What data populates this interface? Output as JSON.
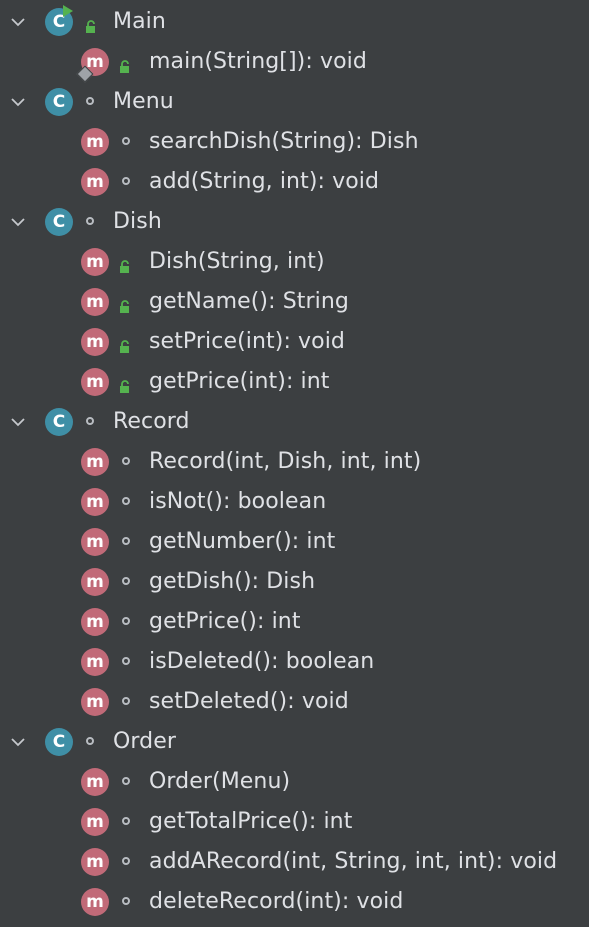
{
  "tree": [
    {
      "class_name": "Main",
      "class_visibility": "public",
      "icon_letter": "C",
      "run_badge": true,
      "methods": [
        {
          "signature": "main(String[]): void",
          "visibility": "public",
          "icon_letter": "m",
          "entry_badge": true
        }
      ]
    },
    {
      "class_name": "Menu",
      "class_visibility": "package",
      "icon_letter": "C",
      "methods": [
        {
          "signature": "searchDish(String): Dish",
          "visibility": "package",
          "icon_letter": "m"
        },
        {
          "signature": "add(String, int): void",
          "visibility": "package",
          "icon_letter": "m"
        }
      ]
    },
    {
      "class_name": "Dish",
      "class_visibility": "package",
      "icon_letter": "C",
      "methods": [
        {
          "signature": "Dish(String, int)",
          "visibility": "public",
          "icon_letter": "m"
        },
        {
          "signature": "getName(): String",
          "visibility": "public",
          "icon_letter": "m"
        },
        {
          "signature": "setPrice(int): void",
          "visibility": "public",
          "icon_letter": "m"
        },
        {
          "signature": "getPrice(int): int",
          "visibility": "public",
          "icon_letter": "m"
        }
      ]
    },
    {
      "class_name": "Record",
      "class_visibility": "package",
      "icon_letter": "C",
      "methods": [
        {
          "signature": "Record(int, Dish, int, int)",
          "visibility": "package",
          "icon_letter": "m"
        },
        {
          "signature": "isNot(): boolean",
          "visibility": "package",
          "icon_letter": "m"
        },
        {
          "signature": "getNumber(): int",
          "visibility": "package",
          "icon_letter": "m"
        },
        {
          "signature": "getDish(): Dish",
          "visibility": "package",
          "icon_letter": "m"
        },
        {
          "signature": "getPrice(): int",
          "visibility": "package",
          "icon_letter": "m"
        },
        {
          "signature": "isDeleted(): boolean",
          "visibility": "package",
          "icon_letter": "m"
        },
        {
          "signature": "setDeleted(): void",
          "visibility": "package",
          "icon_letter": "m"
        }
      ]
    },
    {
      "class_name": "Order",
      "class_visibility": "package",
      "icon_letter": "C",
      "methods": [
        {
          "signature": "Order(Menu)",
          "visibility": "package",
          "icon_letter": "m"
        },
        {
          "signature": "getTotalPrice(): int",
          "visibility": "package",
          "icon_letter": "m"
        },
        {
          "signature": "addARecord(int, String, int, int): void",
          "visibility": "package",
          "icon_letter": "m"
        },
        {
          "signature": "deleteRecord(int): void",
          "visibility": "package",
          "icon_letter": "m"
        }
      ]
    }
  ],
  "colors": {
    "background": "#3c3f41",
    "text": "#dfe1e5",
    "class_icon": "#3f8fa6",
    "method_icon": "#c16a78",
    "public_lock": "#55b24f",
    "package_dot": "#b8bcc1"
  },
  "icons": {
    "expand": "chevron-down-icon",
    "class": "class-icon",
    "method": "method-icon",
    "public": "lock-open-icon",
    "package": "package-private-icon",
    "run": "run-icon",
    "entry": "entry-point-icon"
  }
}
